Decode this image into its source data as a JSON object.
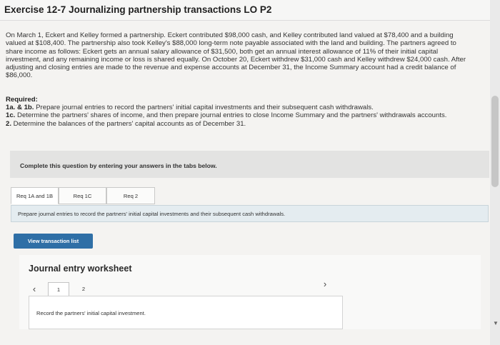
{
  "header": {
    "title": "Exercise 12-7 Journalizing partnership transactions LO P2"
  },
  "problem": {
    "paragraph": "On March 1, Eckert and Kelley formed a partnership. Eckert contributed $98,000 cash, and Kelley contributed land valued at $78,400 and a building valued at $108,400. The partnership also took Kelley's $88,000 long-term note payable associated with the land and building. The partners agreed to share income as follows: Eckert gets an annual salary allowance of $31,500, both get an annual interest allowance of 11% of their initial capital investment, and any remaining income or loss is shared equally. On October 20, Eckert withdrew $31,000 cash and Kelley withdrew $24,000 cash. After adjusting and closing entries are made to the revenue and expense accounts at December 31, the Income Summary account had a credit balance of $86,000."
  },
  "required": {
    "heading": "Required:",
    "items": [
      {
        "num": "1a. & 1b.",
        "text": " Prepare journal entries to record the partners' initial capital investments and their subsequent cash withdrawals."
      },
      {
        "num": "1c.",
        "text": " Determine the partners' shares of income, and then prepare journal entries to close Income Summary and the partners' withdrawals accounts."
      },
      {
        "num": "2.",
        "text": " Determine the balances of the partners' capital accounts as of December 31."
      }
    ]
  },
  "complete_box": {
    "text": "Complete this question by entering your answers in the tabs below."
  },
  "tabs": [
    {
      "label": "Req 1A and 1B",
      "active": true
    },
    {
      "label": "Req 1C",
      "active": false
    },
    {
      "label": "Req 2",
      "active": false
    }
  ],
  "instruction": {
    "text": "Prepare journal entries to record the partners' initial capital investments and their subsequent cash withdrawals."
  },
  "buttons": {
    "view_transaction_list": "View transaction list"
  },
  "worksheet": {
    "title": "Journal entry worksheet",
    "pages": [
      "1",
      "2"
    ],
    "active_page": "1",
    "entry_prompt": "Record the partners' initial capital investment."
  },
  "icons": {
    "prev": "chevron-left-icon",
    "next": "chevron-right-icon"
  },
  "colors": {
    "button_blue": "#2f6fa6",
    "instruction_bg": "#e4ecf0"
  }
}
